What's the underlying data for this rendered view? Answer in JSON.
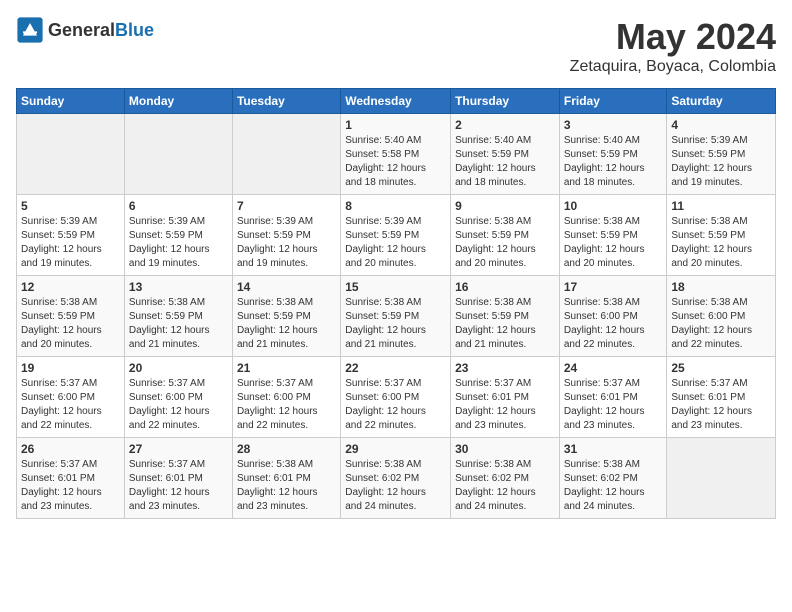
{
  "logo": {
    "text_general": "General",
    "text_blue": "Blue"
  },
  "title": {
    "month": "May 2024",
    "location": "Zetaquira, Boyaca, Colombia"
  },
  "headers": [
    "Sunday",
    "Monday",
    "Tuesday",
    "Wednesday",
    "Thursday",
    "Friday",
    "Saturday"
  ],
  "weeks": [
    [
      {
        "day": "",
        "info": ""
      },
      {
        "day": "",
        "info": ""
      },
      {
        "day": "",
        "info": ""
      },
      {
        "day": "1",
        "info": "Sunrise: 5:40 AM\nSunset: 5:58 PM\nDaylight: 12 hours\nand 18 minutes."
      },
      {
        "day": "2",
        "info": "Sunrise: 5:40 AM\nSunset: 5:59 PM\nDaylight: 12 hours\nand 18 minutes."
      },
      {
        "day": "3",
        "info": "Sunrise: 5:40 AM\nSunset: 5:59 PM\nDaylight: 12 hours\nand 18 minutes."
      },
      {
        "day": "4",
        "info": "Sunrise: 5:39 AM\nSunset: 5:59 PM\nDaylight: 12 hours\nand 19 minutes."
      }
    ],
    [
      {
        "day": "5",
        "info": "Sunrise: 5:39 AM\nSunset: 5:59 PM\nDaylight: 12 hours\nand 19 minutes."
      },
      {
        "day": "6",
        "info": "Sunrise: 5:39 AM\nSunset: 5:59 PM\nDaylight: 12 hours\nand 19 minutes."
      },
      {
        "day": "7",
        "info": "Sunrise: 5:39 AM\nSunset: 5:59 PM\nDaylight: 12 hours\nand 19 minutes."
      },
      {
        "day": "8",
        "info": "Sunrise: 5:39 AM\nSunset: 5:59 PM\nDaylight: 12 hours\nand 20 minutes."
      },
      {
        "day": "9",
        "info": "Sunrise: 5:38 AM\nSunset: 5:59 PM\nDaylight: 12 hours\nand 20 minutes."
      },
      {
        "day": "10",
        "info": "Sunrise: 5:38 AM\nSunset: 5:59 PM\nDaylight: 12 hours\nand 20 minutes."
      },
      {
        "day": "11",
        "info": "Sunrise: 5:38 AM\nSunset: 5:59 PM\nDaylight: 12 hours\nand 20 minutes."
      }
    ],
    [
      {
        "day": "12",
        "info": "Sunrise: 5:38 AM\nSunset: 5:59 PM\nDaylight: 12 hours\nand 20 minutes."
      },
      {
        "day": "13",
        "info": "Sunrise: 5:38 AM\nSunset: 5:59 PM\nDaylight: 12 hours\nand 21 minutes."
      },
      {
        "day": "14",
        "info": "Sunrise: 5:38 AM\nSunset: 5:59 PM\nDaylight: 12 hours\nand 21 minutes."
      },
      {
        "day": "15",
        "info": "Sunrise: 5:38 AM\nSunset: 5:59 PM\nDaylight: 12 hours\nand 21 minutes."
      },
      {
        "day": "16",
        "info": "Sunrise: 5:38 AM\nSunset: 5:59 PM\nDaylight: 12 hours\nand 21 minutes."
      },
      {
        "day": "17",
        "info": "Sunrise: 5:38 AM\nSunset: 6:00 PM\nDaylight: 12 hours\nand 22 minutes."
      },
      {
        "day": "18",
        "info": "Sunrise: 5:38 AM\nSunset: 6:00 PM\nDaylight: 12 hours\nand 22 minutes."
      }
    ],
    [
      {
        "day": "19",
        "info": "Sunrise: 5:37 AM\nSunset: 6:00 PM\nDaylight: 12 hours\nand 22 minutes."
      },
      {
        "day": "20",
        "info": "Sunrise: 5:37 AM\nSunset: 6:00 PM\nDaylight: 12 hours\nand 22 minutes."
      },
      {
        "day": "21",
        "info": "Sunrise: 5:37 AM\nSunset: 6:00 PM\nDaylight: 12 hours\nand 22 minutes."
      },
      {
        "day": "22",
        "info": "Sunrise: 5:37 AM\nSunset: 6:00 PM\nDaylight: 12 hours\nand 22 minutes."
      },
      {
        "day": "23",
        "info": "Sunrise: 5:37 AM\nSunset: 6:01 PM\nDaylight: 12 hours\nand 23 minutes."
      },
      {
        "day": "24",
        "info": "Sunrise: 5:37 AM\nSunset: 6:01 PM\nDaylight: 12 hours\nand 23 minutes."
      },
      {
        "day": "25",
        "info": "Sunrise: 5:37 AM\nSunset: 6:01 PM\nDaylight: 12 hours\nand 23 minutes."
      }
    ],
    [
      {
        "day": "26",
        "info": "Sunrise: 5:37 AM\nSunset: 6:01 PM\nDaylight: 12 hours\nand 23 minutes."
      },
      {
        "day": "27",
        "info": "Sunrise: 5:37 AM\nSunset: 6:01 PM\nDaylight: 12 hours\nand 23 minutes."
      },
      {
        "day": "28",
        "info": "Sunrise: 5:38 AM\nSunset: 6:01 PM\nDaylight: 12 hours\nand 23 minutes."
      },
      {
        "day": "29",
        "info": "Sunrise: 5:38 AM\nSunset: 6:02 PM\nDaylight: 12 hours\nand 24 minutes."
      },
      {
        "day": "30",
        "info": "Sunrise: 5:38 AM\nSunset: 6:02 PM\nDaylight: 12 hours\nand 24 minutes."
      },
      {
        "day": "31",
        "info": "Sunrise: 5:38 AM\nSunset: 6:02 PM\nDaylight: 12 hours\nand 24 minutes."
      },
      {
        "day": "",
        "info": ""
      }
    ]
  ]
}
